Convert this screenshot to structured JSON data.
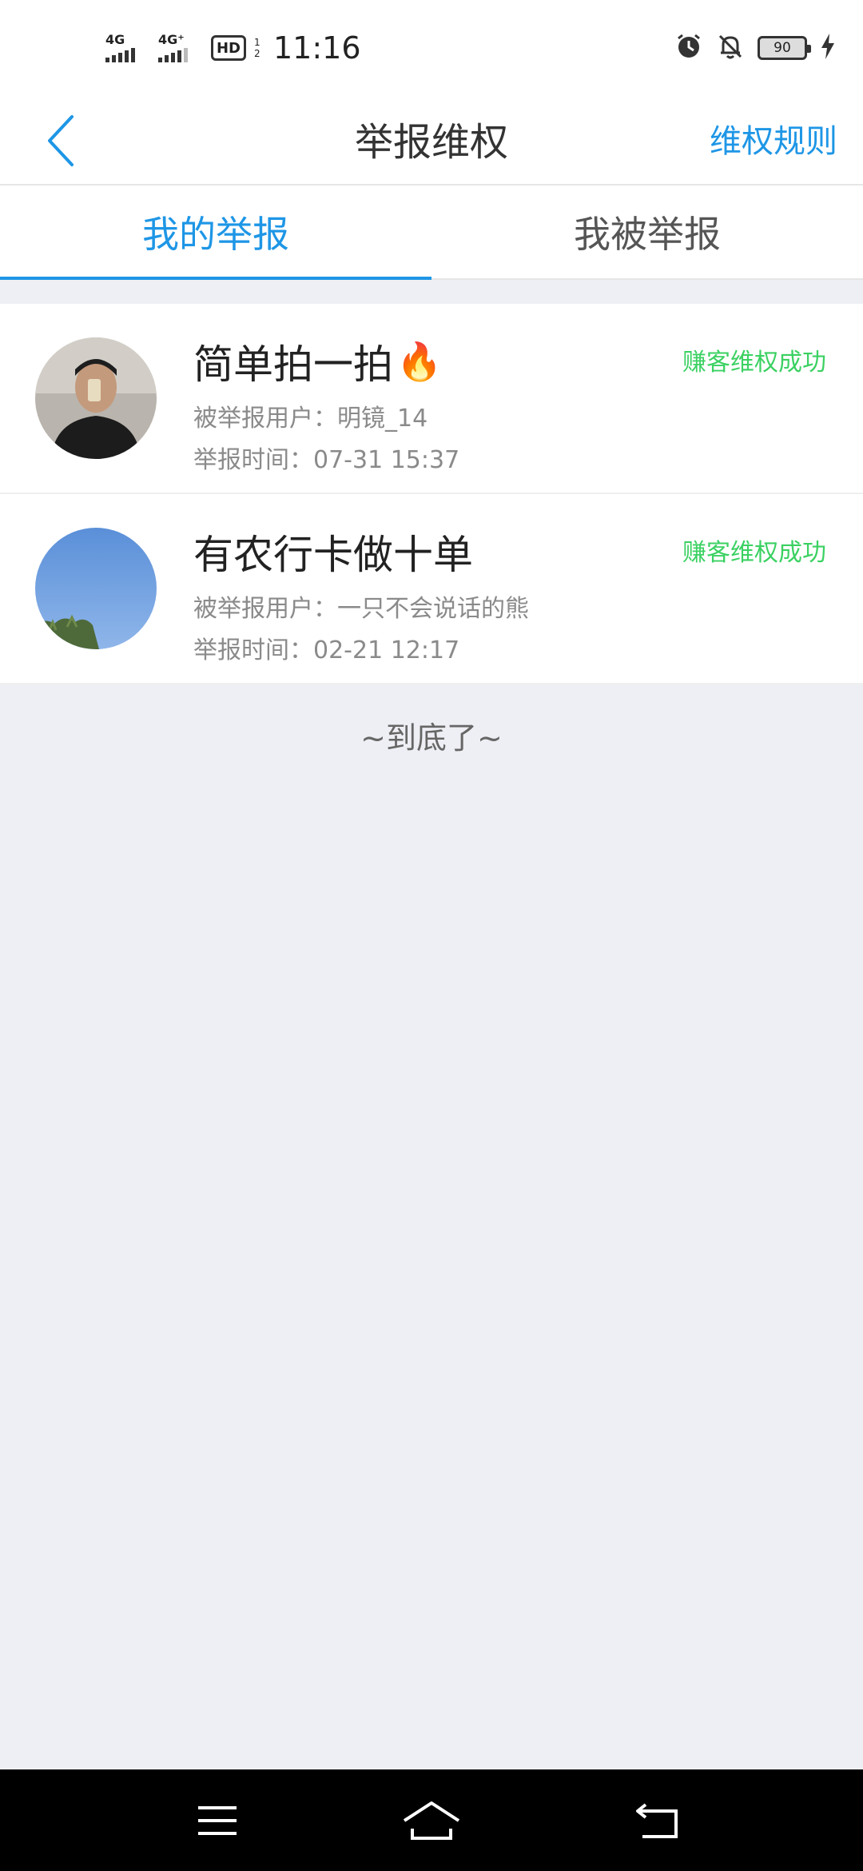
{
  "status_bar": {
    "net1": "4G",
    "net2": "4G⁺",
    "hd": "HD",
    "hd_sub": "1 2",
    "time": "11:16",
    "battery": "90",
    "icons": [
      "signal-icon",
      "alarm-icon",
      "bell-off-icon",
      "battery-icon",
      "charging-icon"
    ]
  },
  "header": {
    "title": "举报维权",
    "right_link": "维权规则",
    "back_icon": "chevron-left-icon"
  },
  "tabs": [
    {
      "label": "我的举报",
      "active": true
    },
    {
      "label": "我被举报",
      "active": false
    }
  ],
  "reports": [
    {
      "title": "简单拍一拍",
      "emoji": "🔥",
      "user_label": "被举报用户：",
      "user": "明镜_14",
      "time_label": "举报时间：",
      "time": "07-31 15:37",
      "status": "赚客维权成功"
    },
    {
      "title": "有农行卡做十单",
      "emoji": "",
      "user_label": "被举报用户：",
      "user": "一只不会说话的熊",
      "time_label": "举报时间：",
      "time": "02-21 12:17",
      "status": "赚客维权成功"
    }
  ],
  "footer_text": "~到底了~",
  "colors": {
    "accent": "#1e96e6",
    "success": "#3bd162",
    "background": "#eeeff4"
  },
  "system_nav": [
    "menu-icon",
    "home-icon",
    "back-icon"
  ]
}
